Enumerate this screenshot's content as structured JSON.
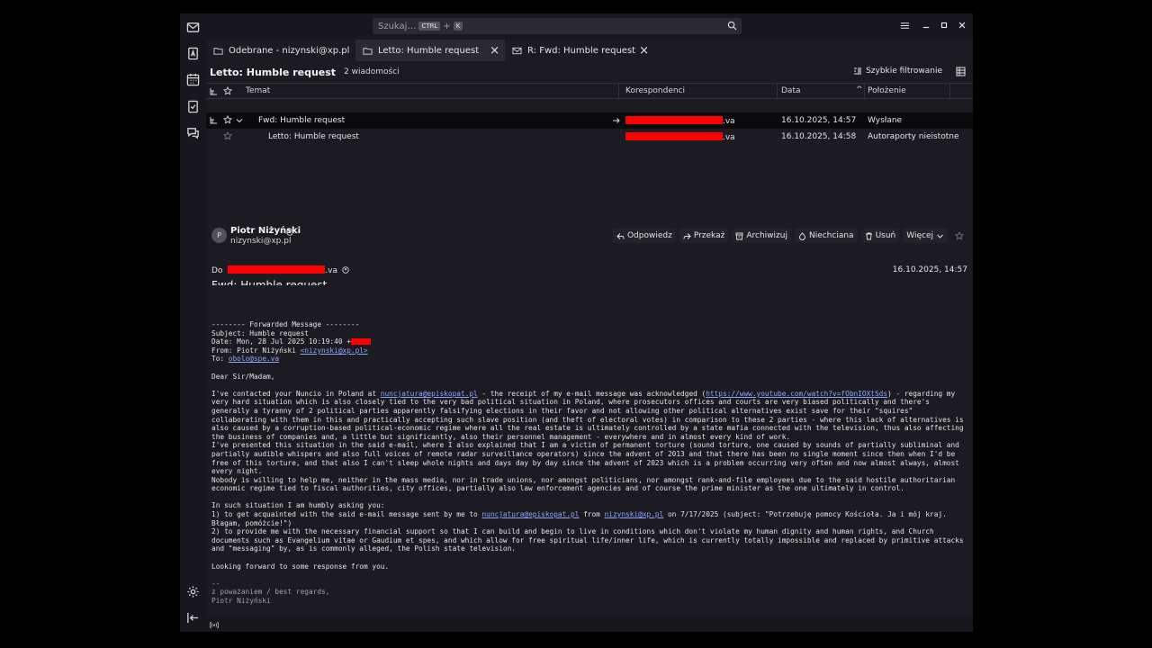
{
  "search": {
    "placeholder": "Szukaj…",
    "kbd_ctrl": "CTRL",
    "kbd_plus": "+",
    "kbd_k": "K"
  },
  "tabs": [
    {
      "label": "Odebrane - nizynski@xp.pl"
    },
    {
      "label": "Letto: Humble request"
    },
    {
      "label": "R: Fwd: Humble request"
    }
  ],
  "thread": {
    "title": "Letto: Humble request",
    "count": "2 wiadomości",
    "quick_filter": "Szybkie filtrowanie"
  },
  "columns": {
    "subject": "Temat",
    "correspondents": "Korespondenci",
    "date": "Data",
    "location": "Położenie"
  },
  "rows": [
    {
      "subject": "Fwd: Humble request",
      "correspondent_suffix": ".va",
      "date": "16.10.2025, 14:57",
      "location": "Wysłane"
    },
    {
      "subject": "Letto: Humble request",
      "correspondent_suffix": ".va",
      "date": "16.10.2025, 14:58",
      "location": "Autoraporty nieistotne"
    }
  ],
  "message": {
    "avatar_letter": "P",
    "from_name": "Piotr Niżyński",
    "from_addr": "nizynski@xp.pl",
    "to_label": "Do",
    "to_suffix": ".va",
    "date": "16.10.2025, 14:57",
    "subject": "Fwd: Humble request",
    "actions": {
      "reply": "Odpowiedz",
      "forward": "Przekaż",
      "archive": "Archiwizuj",
      "junk": "Niechciana",
      "delete": "Usuń",
      "more": "Więcej"
    }
  },
  "body": {
    "fwd_header": "-------- Forwarded Message --------",
    "subject_line": "Subject: Humble request",
    "date_line": "Date: Mon, 28 Jul 2025 10:19:40 +",
    "from_prefix": "From: Piotr Niżyński ",
    "from_link": "<nizynski@xp.pl>",
    "to_prefix": "To: ",
    "to_link": "obolo@spe.va",
    "greeting": "Dear Sir/Madam,",
    "p1_a": "I've contacted your Nuncio in Poland at ",
    "p1_link1": "nuncjatura@episkopat.pl",
    "p1_b": " - the receipt of my e-mail message was acknowledged (",
    "p1_link2": "https://www.youtube.com/watch?v=fObnIOXtSds",
    "p1_c": ") - regarding my very hard situation which is also closely tied to the very bad political situation in Poland, where prosecutors offices and courts are very biased politically and there's generally a tyranny of 2 political parties apparently falsifying elections in their favor and not allowing other political alternatives exist save for their \"squires\" collaborating with them in this and practically accepting such slave position (and theft of electoral votes) in comparison to these 2 parties - where this lack of alternatives is also caused by a corruption-based political-economic regime where all the real estate is ultimately controlled by a state mafia connected with the television, thus also affecting the business of companies and, a little but significantly, also their personnel management - everywhere and in almost every kind of work.",
    "p2": "I've presented this situation in the said e-mail, where I also explained that I am a victim of permanent torture (sound torture, one caused by sounds of partially subliminal and partially audible whispers and also full voices of remote radar surveillance operators) since the advent of 2013 and that there has been no single moment since then when I'd be free of this torture, and that also I can't sleep whole nights and days day by day since the advent of 2023 which is a problem occurring very often and now almost always, almost every night.",
    "p3": "Nobody is willing to help me, neither in the mass media, nor in trade unions, nor amongst politicians, nor amongst rank-and-file employees due to the said hostile authoritarian economic regime tied to fiscal authorities, city offices, partially also law enforcement agencies and of course the prime minister as the one ultimately in control.",
    "ask": "In such situation I am humbly asking you:",
    "i1_a": "1) to get acquainted with the said e-mail message sent by me to ",
    "i1_link1": "nuncjatura@episkopat.pl",
    "i1_b": " from ",
    "i1_link2": "nizynski@xp.pl",
    "i1_c": " on 7/17/2025 (subject: \"Potrzebuję pomocy Kościoła. Ja i mój kraj. Błagam, pomóżcie!\")",
    "i2": "2) to provide me with the necessary financial support so that I can build and begin to live in conditions which don't violate my human dignity and human rights, and Church documents such as Evangelium vitae or Gaudium et spes, and which allow for free spiritual life/inner life, which is currently totally impossible and replaced by primitive attacks and \"messaging\" by, as is commonly alleged, the Polish state television.",
    "closing": "Looking forward to some response from you.",
    "sig_dash": "--",
    "sig_regards": "z poważaniem / best regards,",
    "sig_name": "Piotr Niżyński"
  },
  "colors": {
    "accent_link": "#8ba8ff",
    "redaction": "#ff0000",
    "bg": "#1c1b22"
  },
  "icons": [
    "mail-icon",
    "address-book-icon",
    "calendar-icon",
    "tasks-icon",
    "chat-icon",
    "settings-icon",
    "collapse-icon",
    "search-icon",
    "menu-icon",
    "star-icon",
    "thread-icon",
    "filter-icon",
    "column-picker-icon",
    "online-icon"
  ]
}
